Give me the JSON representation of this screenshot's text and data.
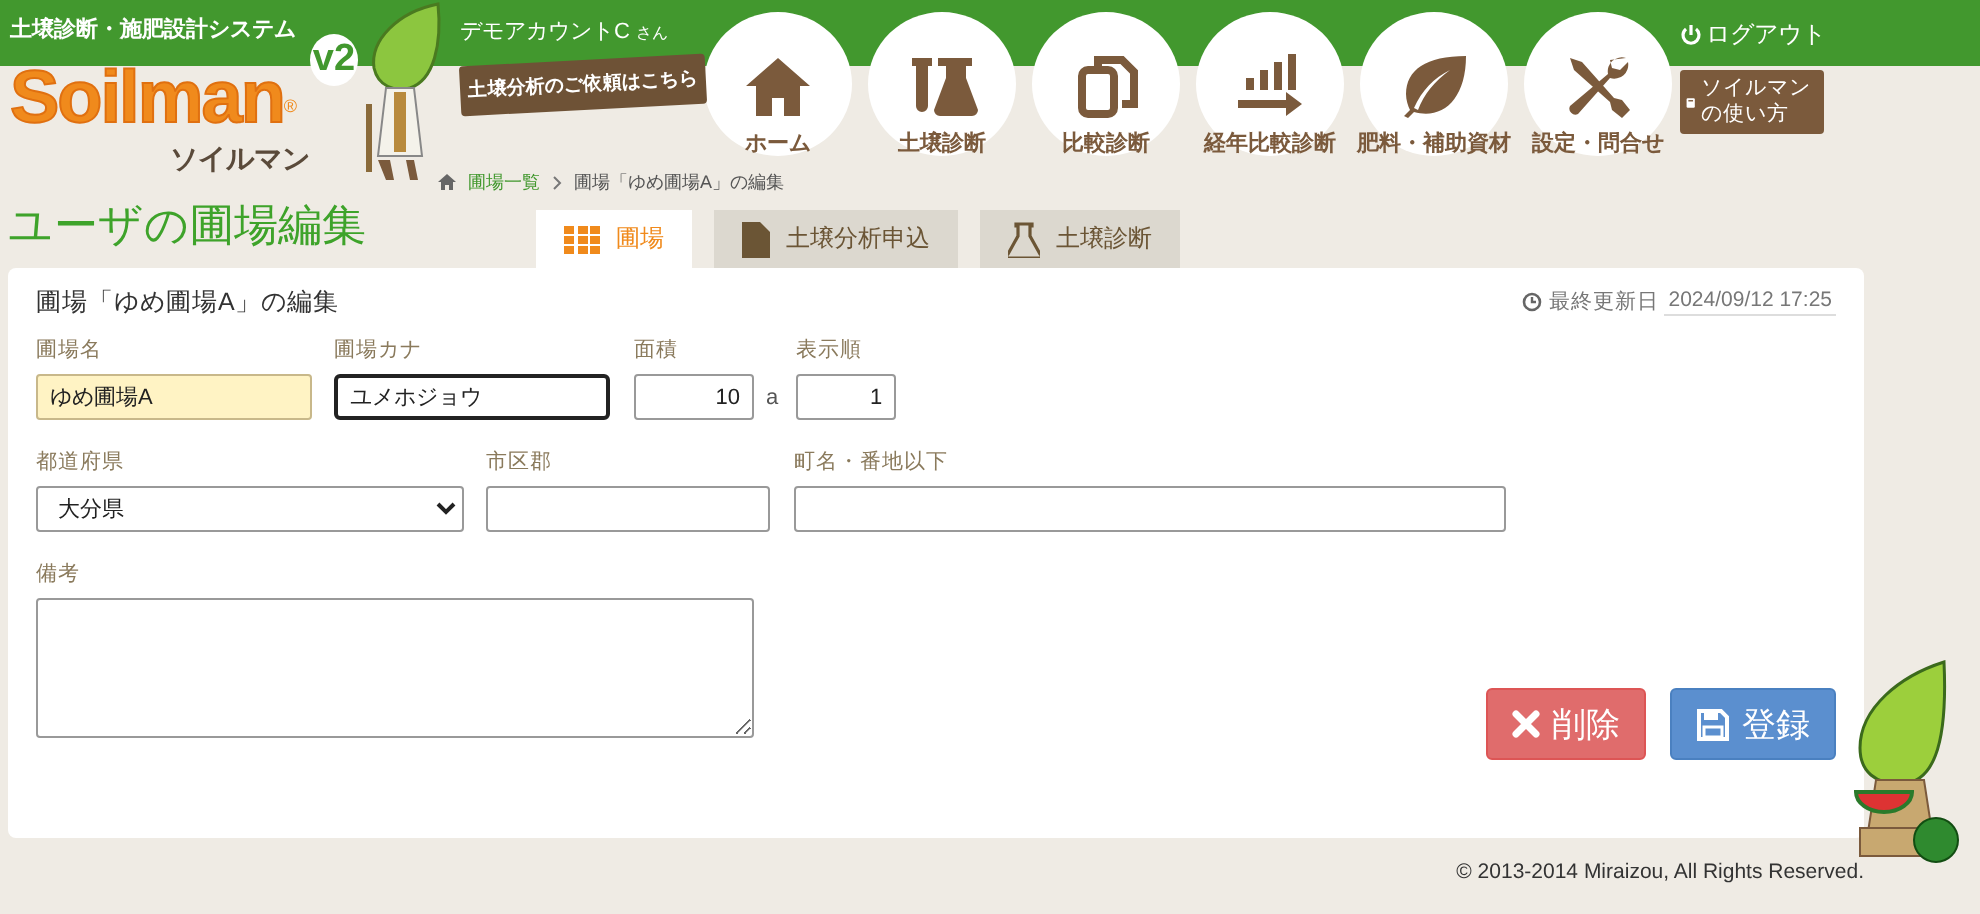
{
  "header": {
    "system_name": "土壌診断・施肥設計システム",
    "logo": {
      "wordmark": "Soilman",
      "registered": "®",
      "reading": "ソイルマン",
      "version": "v2"
    },
    "account": {
      "name": "デモアカウントC",
      "honorific": "さん"
    },
    "request_badge": "土壌分析のご依頼はこちら",
    "logout": "ログアウト",
    "nav": [
      {
        "label": "ホーム"
      },
      {
        "label": "土壌診断"
      },
      {
        "label": "比較診断"
      },
      {
        "label": "経年比較診断"
      },
      {
        "label": "肥料・補助資材"
      },
      {
        "label": "設定・問合せ"
      }
    ],
    "guide_button": "ソイルマンの使い方"
  },
  "breadcrumb": [
    "圃場一覧",
    "圃場「ゆめ圃場A」の編集"
  ],
  "page_title": "ユーザの圃場編集",
  "tabs": [
    {
      "label": "圃場",
      "selected": true
    },
    {
      "label": "土壌分析申込",
      "selected": false
    },
    {
      "label": "土壌診断",
      "selected": false
    }
  ],
  "form": {
    "heading": "圃場「ゆめ圃場A」の編集",
    "last_updated_label": "最終更新日",
    "last_updated": "2024/09/12 17:25",
    "fields": [
      {
        "label": "圃場名",
        "kind": "text",
        "value": "ゆめ圃場A",
        "highlighted": true,
        "focused": false
      },
      {
        "label": "圃場カナ",
        "kind": "text",
        "value": "ユメホジョウ",
        "highlighted": false,
        "focused": true
      },
      {
        "label": "面積",
        "kind": "number",
        "value": "10",
        "unit": "a",
        "highlighted": false,
        "focused": false
      },
      {
        "label": "表示順",
        "kind": "number",
        "value": "1",
        "highlighted": false,
        "focused": false
      },
      {
        "label": "都道府県",
        "kind": "select",
        "value": "大分県",
        "highlighted": false,
        "focused": false
      },
      {
        "label": "市区郡",
        "kind": "text",
        "highlighted": false,
        "focused": false
      },
      {
        "label": "町名・番地以下",
        "kind": "text",
        "highlighted": false,
        "focused": false
      },
      {
        "label": "備考",
        "kind": "textarea",
        "highlighted": false,
        "focused": false
      }
    ],
    "buttons": [
      {
        "label": "削除",
        "kind": "danger"
      },
      {
        "label": "登録",
        "kind": "primary"
      }
    ]
  },
  "footer": "© 2013-2014 Miraizou, All Rights Reserved."
}
